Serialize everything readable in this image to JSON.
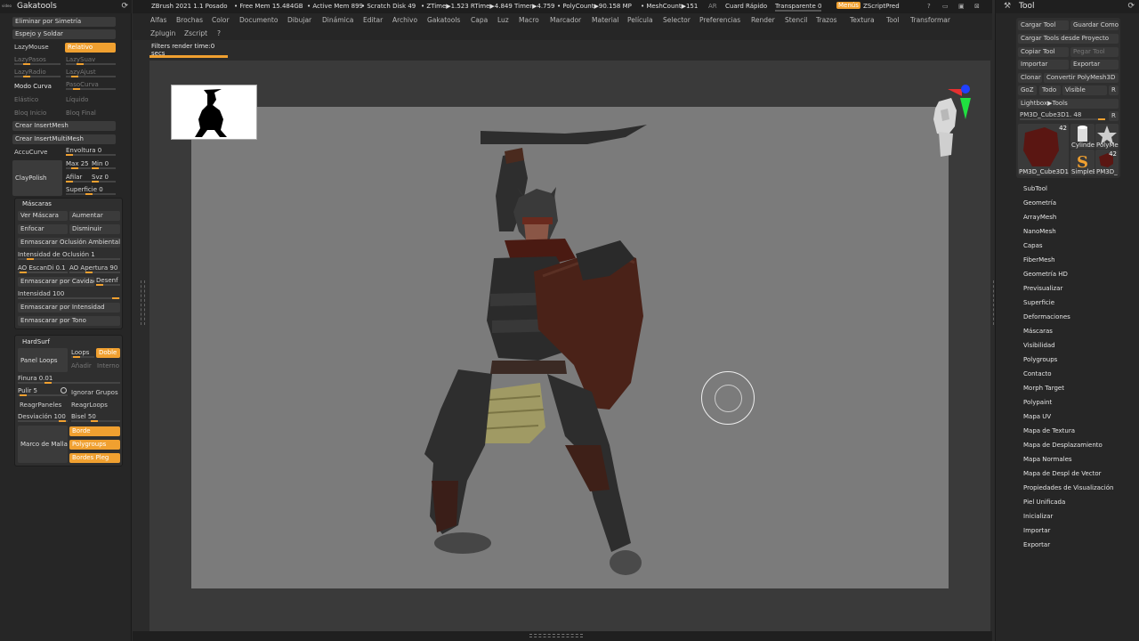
{
  "left_palette": {
    "tiny_label": "video",
    "title": "Gakatools",
    "pin_icon": "sync-icon",
    "buttons": {
      "eliminar": "Eliminar por Simetría",
      "espejo": "Espejo y Soldar",
      "lazymouse": "LazyMouse",
      "relativo": "Relativo",
      "lazypasos": "LazyPasos",
      "lazysuav": "LazySuav",
      "lazyradio": "LazyRadio",
      "lazyajust": "LazyAjust",
      "modo_curva": "Modo Curva",
      "paso_curva": "PasoCurva",
      "elastico": "Elástico",
      "liquido": "Líquido",
      "bloq_inicio": "Bloq Inicio",
      "bloq_final": "Bloq Final",
      "crear_insertmesh": "Crear InsertMesh",
      "crear_insertmultimesh": "Crear InsertMultiMesh",
      "accucurve": "AccuCurve",
      "envoltura": "Envoltura 0",
      "claypolish": "ClayPolish",
      "max": "Max 25",
      "min": "Min 0",
      "afilar": "Afilar",
      "svz": "Svz 0",
      "superficie": "Superficie 0"
    },
    "mascaras": {
      "title": "Máscaras",
      "ver_mascara": "Ver Máscara",
      "aumentar": "Aumentar",
      "enfocar": "Enfocar",
      "disminuir": "Disminuir",
      "enmascarar_oclusion": "Enmascarar Oclusión Ambiental",
      "intensidad_oclusion": "Intensidad de Oclusión 1",
      "ao_escan": "AO EscanDi 0.1",
      "ao_apertura": "AO Apertura 90",
      "enmascarar_cavidad": "Enmascarar por Cavidad",
      "desenf": "Desenf",
      "intensidad": "Intensidad 100",
      "enmascarar_intensidad": "Enmascarar por Intensidad",
      "enmascarar_tono": "Enmascarar por Tono"
    },
    "hardsurf": {
      "title": "HardSurf",
      "panel_loops": "Panel Loops",
      "loops": "Loops",
      "doble": "Doble",
      "anadir": "Añadir",
      "interno": "Interno",
      "finura": "Finura 0.01",
      "pulir": "Pulir 5",
      "ignorar_grupos": "Ignorar Grupos",
      "reagr_paneles": "ReagrPaneles",
      "reagr_loops": "ReagrLoops",
      "desviacion": "Desviación 100",
      "bisel": "Bisel 50",
      "marco_malla": "Marco de Malla",
      "borde": "Borde",
      "polygroups": "Polygroups",
      "bordes_pleg": "Bordes Pleg"
    }
  },
  "topbar": {
    "app": "ZBrush 2021 1.1 Posado",
    "free_mem": "• Free Mem 15.484GB",
    "active_mem": "• Active Mem 899",
    "scratch": "• Scratch Disk 49",
    "ztime": "• ZTime▶1.523 RTime▶4.849 Timer▶4.759",
    "polycount": "• PolyCount▶90.158 MP",
    "meshcount": "• MeshCount▶151",
    "ar": "AR",
    "cuard": "Cuard Rápido",
    "transparente": "Transparente 0",
    "menus": "Menús",
    "zscript": "ZScriptPred",
    "icons": [
      "help-icon",
      "minimize-icon",
      "maximize-icon",
      "close-icon"
    ]
  },
  "menubar": {
    "row1": [
      "Alfas",
      "Brochas",
      "Color",
      "Documento",
      "Dibujar",
      "Dinámica",
      "Editar",
      "Archivo",
      "Gakatools",
      "Capa",
      "Luz",
      "Macro",
      "Marcador",
      "Material",
      "Película",
      "Selector",
      "Preferencias",
      "Render",
      "Stencil",
      "Trazos",
      "Textura",
      "Tool",
      "Transformar"
    ],
    "row2": [
      "Zplugin",
      "Zscript",
      "?"
    ]
  },
  "status": {
    "text": "Filters render time:0 secs",
    "progress": 1.0
  },
  "right_palette": {
    "title": "Tool",
    "header_icon": "hammer-icon",
    "pin_icon": "sync-icon",
    "buttons": {
      "cargar_tool": "Cargar Tool",
      "guardar_como": "Guardar Como",
      "cargar_proyecto": "Cargar Tools desde Proyecto",
      "copiar_tool": "Copiar Tool",
      "pegar_tool": "Pegar Tool",
      "importar": "Importar",
      "exportar": "Exportar",
      "clonar": "Clonar",
      "convertir": "Convertir PolyMesh3D",
      "goz": "GoZ",
      "todo": "Todo",
      "visible": "Visible",
      "r": "R",
      "lightbox": "Lightbox▶Tools",
      "current_tool": "PM3D_Cube3D1. 48",
      "r2": "R"
    },
    "thumbs": {
      "main_count": "42",
      "main_caption": "PM3D_Cube3D1",
      "cylinder": "Cylinde",
      "polymesh": "PolyMe",
      "simple": "SimpleB",
      "pm3d_count": "42",
      "pm3d": "PM3D_"
    },
    "list": [
      "SubTool",
      "Geometría",
      "ArrayMesh",
      "NanoMesh",
      "Capas",
      "FiberMesh",
      "Geometría HD",
      "Previsualizar",
      "Superficie",
      "Deformaciones",
      "Máscaras",
      "Visibilidad",
      "Polygroups",
      "Contacto",
      "Morph Target",
      "Polypaint",
      "Mapa UV",
      "Mapa de Textura",
      "Mapa de Desplazamiento",
      "Mapa Normales",
      "Mapa de Despl de Vector",
      "Propiedades de Visualización",
      "Piel Unificada",
      "Inicializar",
      "Importar",
      "Exportar"
    ]
  },
  "colors": {
    "accent": "#f0a030",
    "panel": "#262626",
    "canvas_bg": "#7b7b7b"
  }
}
